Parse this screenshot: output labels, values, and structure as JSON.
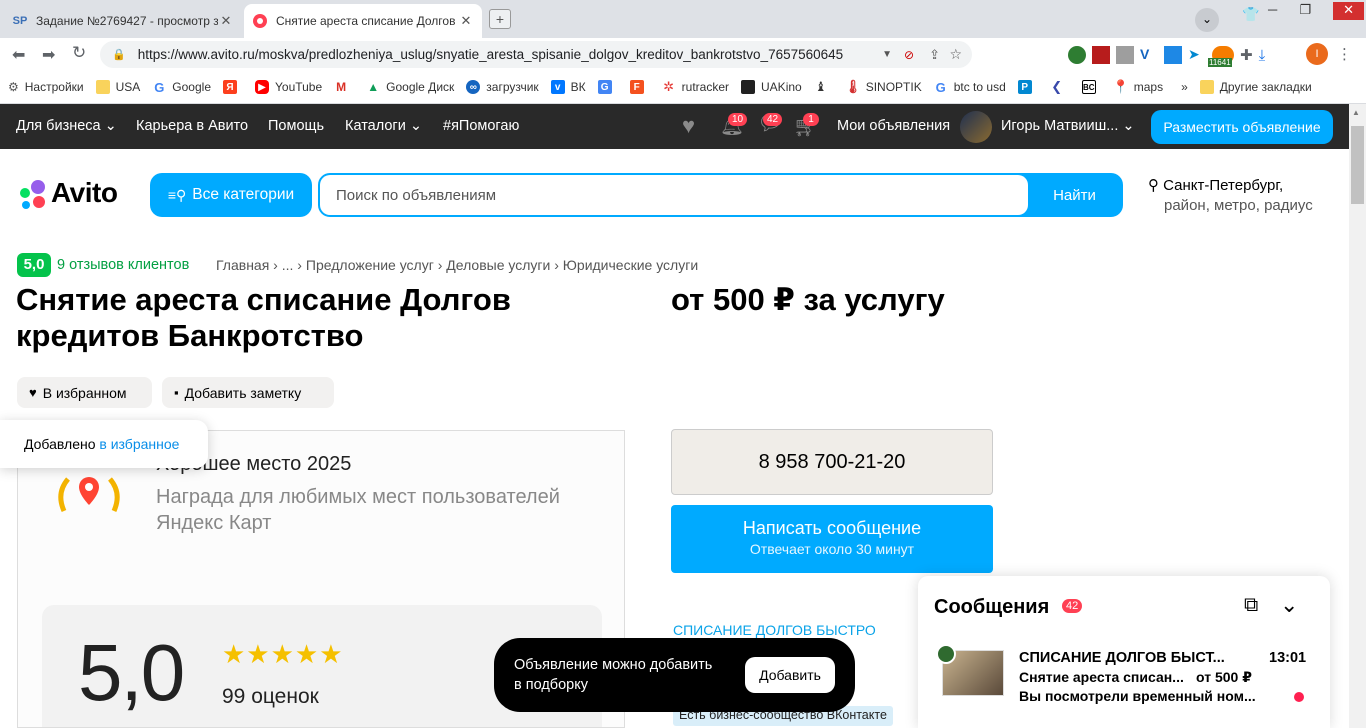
{
  "browser": {
    "tabs": [
      {
        "favicon": "SP",
        "title": "Задание №2769427 - просмотр з"
      },
      {
        "favicon": "avito-icon",
        "title": "Снятие ареста списание Долгов к"
      }
    ],
    "url": "https://www.avito.ru/moskva/predlozheniya_uslug/snyatie_aresta_spisanie_dolgov_kreditov_bankrotstvo_7657560645",
    "ext_badge": "11641",
    "profile_initial": "I",
    "bookmarks": [
      "Настройки",
      "USA",
      "Google",
      "",
      "YouTube",
      "",
      "Google Диск",
      "загрузчик",
      "ВК",
      "",
      "",
      "rutracker",
      "UAKino",
      "",
      "SINOPTIK",
      "btc to usd",
      "",
      "",
      "",
      "maps"
    ],
    "other_bookmarks": "Другие закладки"
  },
  "topnav": {
    "business": "Для бизнеса",
    "career": "Карьера в Авито",
    "help": "Помощь",
    "catalogs": "Каталоги",
    "ihelp": "#яПомогаю",
    "notif_count": "10",
    "msg_count": "42",
    "cart_count": "1",
    "my_ads": "Мои объявления",
    "user_name": "Игорь Матвииш...",
    "post_ad": "Разместить объявление"
  },
  "search": {
    "logo": "Avito",
    "categories_label": "Все категории",
    "placeholder": "Поиск по объявлениям",
    "find_label": "Найти",
    "city": "Санкт-Петербург,",
    "location_hint": "район, метро, радиус"
  },
  "rating": {
    "score": "5,0",
    "reviews": "9 отзывов клиентов"
  },
  "breadcrumbs": [
    "Главная",
    "...",
    "Предложение услуг",
    "Деловые услуги",
    "Юридические услуги"
  ],
  "ad": {
    "title": "Снятие ареста списание Долгов кредитов Банкротство",
    "price": "от 500 ₽ за услугу",
    "favorite_label": "В избранном",
    "note_label": "Добавить заметку",
    "toast_prefix": "Добавлено ",
    "toast_link": "в избранное",
    "phone": "8 958 700-21-20",
    "message_label": "Написать сообщение",
    "message_sub": "Отвечает около 30 минут",
    "seller_name": "СПИСАНИЕ ДОЛГОВ БЫСТРО",
    "business_tag": "Есть бизнес-сообщество ВКонтакте"
  },
  "image": {
    "award_title": "Хорошее место 2025",
    "award_text1": "Награда для любимых мест пользователей",
    "award_text2": "Яндекс Карт",
    "score": "5,0",
    "stars": 5,
    "ratings_count": "99 оценок"
  },
  "compilation_toast": {
    "text1": "Объявление можно добавить",
    "text2": "в подборку",
    "button": "Добавить"
  },
  "messages": {
    "title": "Сообщения",
    "count": "42",
    "item": {
      "name": "СПИСАНИЕ ДОЛГОВ БЫСТ...",
      "time": "13:01",
      "ad_title": "Снятие ареста списан...",
      "ad_price": "от 500 ₽",
      "preview": "Вы посмотрели временный ном..."
    }
  }
}
